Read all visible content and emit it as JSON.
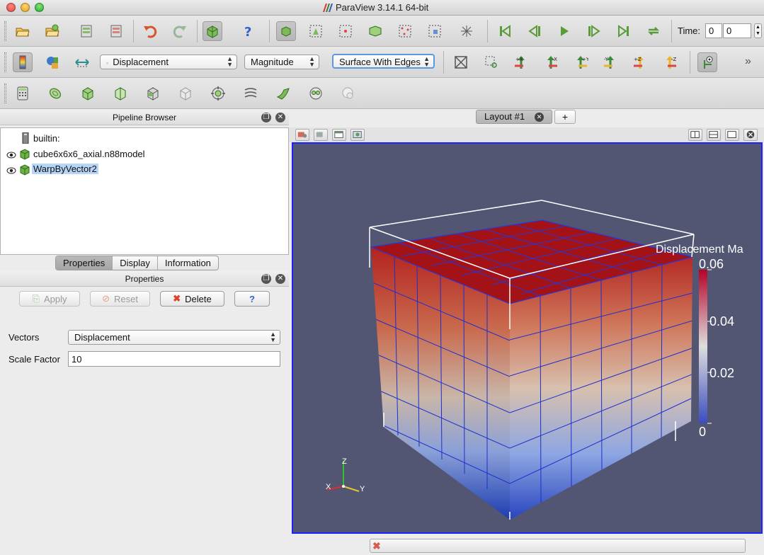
{
  "window": {
    "title": "ParaView 3.14.1 64-bit"
  },
  "toolbar_main": {
    "time_label": "Time:",
    "time_value": "0",
    "time_index": "0"
  },
  "toolbar_color": {
    "color_by": "Displacement",
    "component": "Magnitude",
    "representation": "Surface With Edges",
    "overflow": "»"
  },
  "pipeline_browser": {
    "title": "Pipeline Browser",
    "items": [
      {
        "label": "builtin:"
      },
      {
        "label": "cube6x6x6_axial.n88model"
      },
      {
        "label": "WarpByVector2"
      }
    ]
  },
  "panel_tabs": [
    "Properties",
    "Display",
    "Information"
  ],
  "properties": {
    "title": "Properties",
    "apply_label": "Apply",
    "reset_label": "Reset",
    "delete_label": "Delete",
    "help_label": "?",
    "vectors_label": "Vectors",
    "vectors_value": "Displacement",
    "scale_label": "Scale Factor",
    "scale_value": "10"
  },
  "layout": {
    "tab_label": "Layout #1",
    "add_tab": "+"
  },
  "render_view": {
    "background": "#525672",
    "colorbar": {
      "title": "Displacement Ma",
      "ticks": [
        "0.06",
        "0.04",
        "0.02",
        "0"
      ]
    },
    "axes": {
      "x": "X",
      "y": "Y",
      "z": "Z"
    }
  },
  "icons": {
    "toolbar_row1": [
      "open-icon",
      "open-recent-icon",
      "connect-icon",
      "disconnect-icon",
      "undo-icon",
      "redo-icon",
      "reset-camera-icon",
      "help-icon",
      "select-cells-icon",
      "select-points-icon",
      "select-frustum-cells-icon",
      "select-block-icon",
      "select-frustum-points-icon",
      "select-interactive-icon",
      "pick-icon",
      "first-frame-icon",
      "previous-frame-icon",
      "play-icon",
      "next-frame-icon",
      "last-frame-icon",
      "loop-icon"
    ],
    "toolbar_row2": [
      "edit-color-map-icon",
      "color-legend-icon",
      "rescale-range-icon",
      "reset-camera-icon",
      "zoom-to-box-icon",
      "set-view-plus-x-icon",
      "set-view-minus-x-icon",
      "set-view-plus-y-icon",
      "set-view-minus-y-icon",
      "set-view-plus-z-icon",
      "set-view-minus-z-icon",
      "center-axes-icon"
    ],
    "toolbar_row3": [
      "calculator-icon",
      "contour-icon",
      "clip-icon",
      "slice-icon",
      "threshold-icon",
      "extract-subset-icon",
      "glyph-icon",
      "stream-tracer-icon",
      "warp-by-vector-icon",
      "group-datasets-icon",
      "extract-level-icon"
    ]
  }
}
